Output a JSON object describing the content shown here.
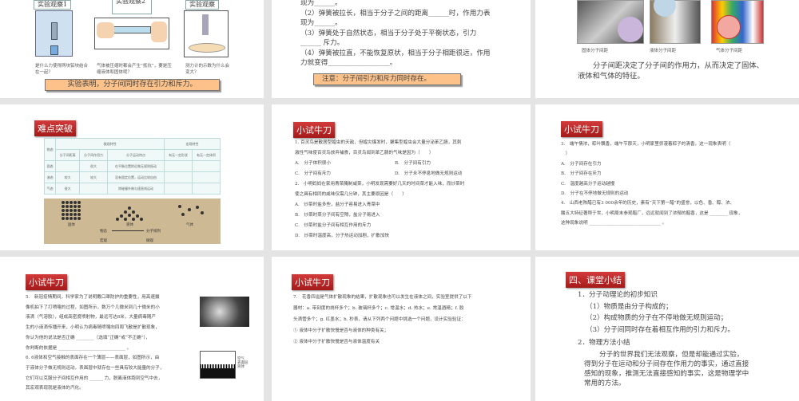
{
  "slides": [
    {
      "obs": [
        "实验观察1",
        "实验观察2",
        "实验观察"
      ],
      "captions": [
        "是什么力使得两块铅块结合在一起？",
        "气体被压缩时都会产生“抵抗”，要是压缩液体和固体呢？",
        "测力计的示数为什么会变大？"
      ],
      "banner": "实验表明，分子间同时存在引力和斥力。"
    },
    {
      "lines": [
        "现为______。",
        "（2）弹簧被拉长，相当于分子之间的距离______时，作用力表",
        "现为______。",
        "（3）弹簧处于自然状态，相当于分子处于平衡状态，引力",
        "______ 斥力。",
        "（4）弹簧被拉直，不能恢复原状，相当于分子相距很远，作用",
        "力就变得__________________。"
      ],
      "banner": "注意：分子间引力和斥力同时存在。"
    },
    {
      "captions": [
        "固体分子间距",
        "液体分子间距",
        "气体分子间距"
      ],
      "para": "分子间距决定了分子间的作用力，从而决定了固体、液体和气体的特征。"
    },
    {
      "label": "难点突破",
      "table": {
        "h1": [
          "物态",
          "微观特性",
          "宏观特性"
        ],
        "h2": [
          "分子间距离",
          "分子间作用力",
          "分子运动特点",
          "有无一定形状",
          "有无一定体积"
        ],
        "rows": [
          [
            "固态",
            "",
            "很大",
            "在平衡位置附近做无规则振动",
            "",
            ""
          ],
          [
            "液态",
            "较大",
            "较大",
            "没有固定位置，运动比较自由",
            "",
            ""
          ],
          [
            "气态",
            "很大",
            "",
            "除碰撞外做匀速直线运动",
            "",
            ""
          ]
        ]
      },
      "diagram": {
        "states": [
          "固体",
          "液体",
          "气体"
        ],
        "left": "物态",
        "right": "分子排列",
        "bl": "宏观",
        "br": "微观"
      }
    },
    {
      "label": "小试牛刀",
      "q1": [
        "1. 百灵鸟是散居型蝗虫的天敌，但蝗灾爆发时，聚集型蝗虫会大量分泌苯乙腈，其刺",
        "激性气味使百灵鸟放弃捕食，百灵鸟闻到苯乙腈的气味是因为（　　）"
      ],
      "q1opts": [
        "A.　分子体积很小",
        "B.　分子间有引力",
        "C.　分子间有斥力",
        "D.　分子永不停息地做无规则运动"
      ],
      "q2": [
        "2.　小明妈妈在家用青菜腌制咸菜，小明发现需要好几天的时间菜才能入味，而炒菜时",
        "使之具有相同的咸味仅需几分钟，其主要原因是（　　）"
      ],
      "q2opts": [
        "A.　炒菜时盐多些，盐分子容易进入青菜中",
        "B.　炒菜时菜分子间有空隙，盐分子易进入",
        "C.　炒菜时盐分子间有相互作用的斥力",
        "D.　炒菜时温度高，分子热运动加剧，扩散加快"
      ]
    },
    {
      "label": "小试牛刀",
      "lines": [
        "3.　端午情浓，粽叶飘香，端午节那天，小明家里弥漫着粽子的清香，这一现象表明（",
        "　）",
        "A.　分子间存在引力",
        "B.　分子间存在斥力",
        "C.　温度越高分子运动越慢",
        "D.　分子在不停地做无规则的运动",
        "4.　山西老陈醋已有3 000余年的历史，素有“天下第一醋”的盛誉，以色、香、醇、浓、",
        "酸五大特征著称于世，小明周末参观醋厂，远远就闻到了浓郁的醋香，这是 ________ 现象，",
        "这种现象说明 ________________________________ 。"
      ]
    },
    {
      "label": "小试牛刀",
      "lines": [
        "5.　新冠疫情期间，科学家为了说明戴口罩防护的重要性，用高速摄",
        "像机拍下了打喷嚏的过程，如图所示，数万个几微米到几十微米的小",
        "液滴（气溶胶），组成高密度喷射物，最远可达8米，大量病毒随产",
        "生的小液滴传播开来，小明认为病毒随喷嚏向四周飞散是扩散现象，",
        "你认为他的说法是否正确 ________（选填“正确”或“不正确”），",
        "你判断的依据是 ______________________________ 。",
        "6. 6液体和空气接触的表面存在一个薄层——表面层，如图所示，由",
        "于液体分子做无规则运动，表面层中就存在一些具有较大能量的分子，",
        "它们可以克服分子间相互作用的 ______ 力，脱离液体跑到空气中去，",
        "其宏观表现就是液体的汽化。"
      ],
      "fig": [
        "空气",
        "表面层",
        "液体"
      ]
    },
    {
      "label": "小试牛刀",
      "lines": [
        "7.　花香四溢是气体扩散现象的结果，扩散现象也可以发生在液体之间，实验室提供了以下",
        "器材：a. 带刻度的烧杯多个；b. 玻璃杯多个；c. 常温水；d. 热水；e. 常温酒精；f. 胶",
        "头滴管多个；g. 红墨水；h. 秒表，请从下列两个问题中挑选一个问题，设计实验验证：",
        "① 液体中分子扩散快慢是否与液体的种类有关；",
        "② 液体中分子扩散快慢是否与液体温度有关"
      ]
    },
    {
      "label": "四、课堂小结",
      "h1": "1．分子动理论的初步知识",
      "items": [
        "（1）物质是由分子构成的；",
        "（2）构成物质的分子在不停地做无规则运动；",
        "（3）分子间同时存在着相互作用的引力和斥力。"
      ],
      "h2": "2．物理方法小结",
      "para": "分子的世界我们无法观察，但是却能通过实验，得到分子在运动和分子间存在作用力的事实，通过直接感知的现象，推测无法直接感知的事实，这是物理学中常用的方法。"
    }
  ]
}
